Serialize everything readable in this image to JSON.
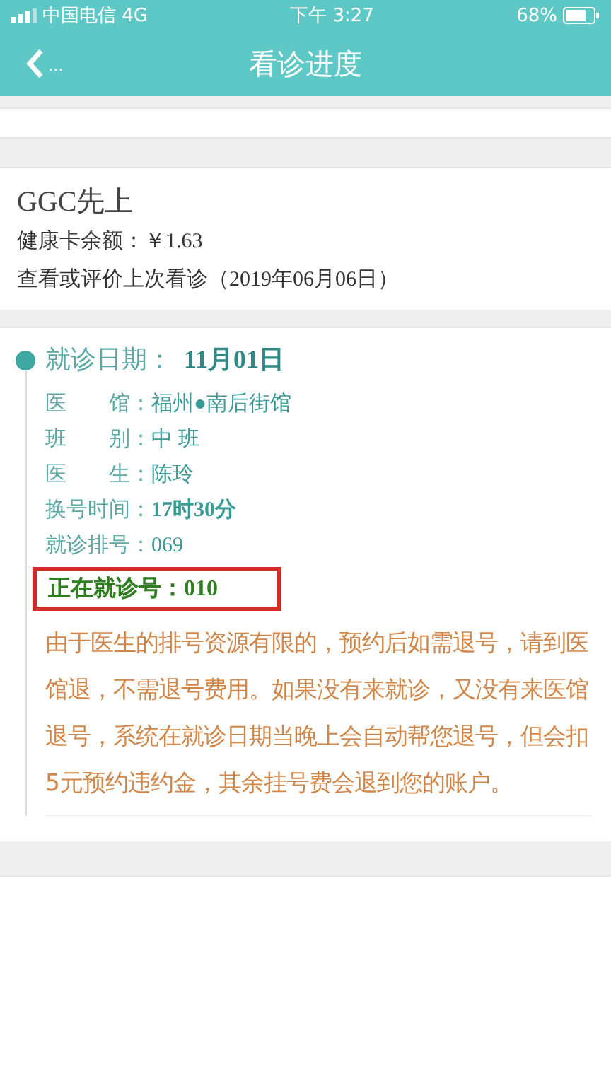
{
  "status_bar": {
    "carrier": "中国电信 4G",
    "time": "下午 3:27",
    "battery": "68%"
  },
  "nav": {
    "back": "...",
    "title": "看诊进度"
  },
  "account": {
    "name": "GGC先上",
    "balance": "健康卡余额：￥1.63",
    "last_visit": "查看或评价上次看诊（2019年06月06日）"
  },
  "visit": {
    "date_label": "就诊日期：",
    "date": "11月01日",
    "rows": [
      {
        "label": "医　　馆：",
        "value": "福州●南后街馆",
        "bold": false
      },
      {
        "label": "班　　别：",
        "value": "中 班",
        "bold": false
      },
      {
        "label": "医　　生：",
        "value": "陈玲",
        "bold": false
      },
      {
        "label": "换号时间：",
        "value": "17时30分",
        "bold": true
      },
      {
        "label": "就诊排号：",
        "value": "069",
        "bold": false
      }
    ],
    "current": {
      "text": "正在就诊号：010",
      "highlighted": true
    },
    "notice": "由于医生的排号资源有限的，预约后如需退号，请到医馆退，不需退号费用。如果没有来就诊，又没有来医馆退号，系统在就诊日期当晚上会自动帮您退号，但会扣5元预约违约金，其余挂号费会退到您的账户。"
  }
}
